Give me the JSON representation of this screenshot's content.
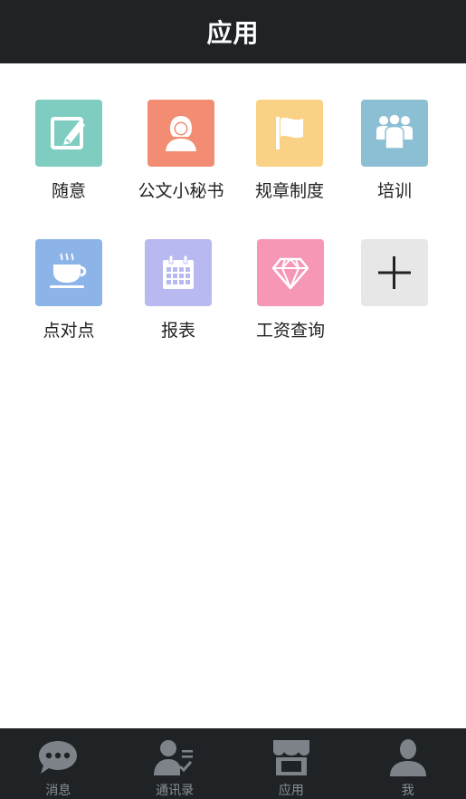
{
  "header": {
    "title": "应用"
  },
  "apps": [
    {
      "label": "随意",
      "color": "#7fcdc0",
      "icon": "edit-icon"
    },
    {
      "label": "公文小秘书",
      "color": "#f28c73",
      "icon": "secretary-icon"
    },
    {
      "label": "规章制度",
      "color": "#fad285",
      "icon": "flag-icon"
    },
    {
      "label": "培训",
      "color": "#8cbfd3",
      "icon": "group-icon"
    },
    {
      "label": "点对点",
      "color": "#8db4e8",
      "icon": "coffee-icon"
    },
    {
      "label": "报表",
      "color": "#b8b9f0",
      "icon": "calendar-icon"
    },
    {
      "label": "工资查询",
      "color": "#f797b6",
      "icon": "diamond-icon"
    },
    {
      "label": "",
      "color": "#e7e7e7",
      "icon": "plus-icon"
    }
  ],
  "tabbar": {
    "items": [
      {
        "label": "消息",
        "icon": "chat-bubble-icon"
      },
      {
        "label": "通讯录",
        "icon": "contacts-icon"
      },
      {
        "label": "应用",
        "icon": "store-icon"
      },
      {
        "label": "我",
        "icon": "person-icon"
      }
    ]
  },
  "colors": {
    "header_bg": "#1f2326",
    "tabbar_bg": "#1f2326",
    "tab_inactive": "#8a9096"
  }
}
